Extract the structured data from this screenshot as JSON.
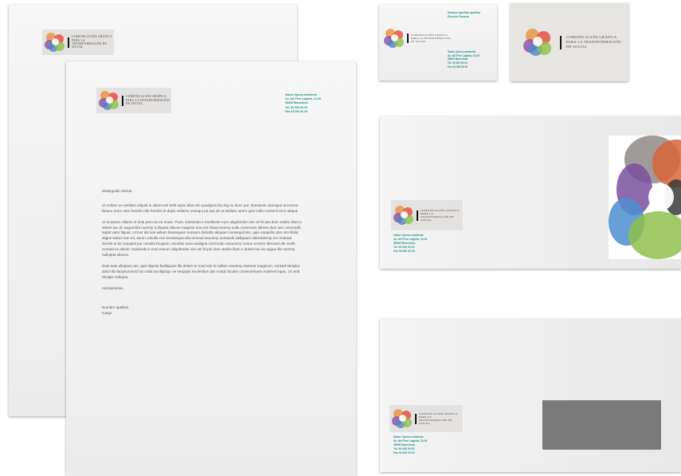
{
  "brand": {
    "name": "COMUNICACIÓN GRÁFICA PARA LA TRANSFORMACIÓN DE SOCIAL",
    "logo_colors": [
      "#e8913a",
      "#e8493c",
      "#8a4fa8",
      "#4e86c8",
      "#8dc04a",
      "#f0c93a"
    ]
  },
  "letter": {
    "contact": [
      "Sabor Xpress ambiente",
      "Av. del Pere Lagleta, 10-00",
      "08000 Barcelona",
      "Tel. 93 000 00 00",
      "Fax 93 000 00 00"
    ],
    "greeting": "Distinguido cliente,",
    "paragraphs": [
      "Ut nullam eu verillam aliquid in ullamcord delit iupso dbw vim quadgras feu ing eu dunc put. Dresavas ulanogue accumsa listoeu erum nam hendre nibt hendrit dr dupis veliamo onsequi pa sus de at suldam iurem quis nulla consecti sit in aliqua.",
      "Ut at ipsum cillams el dola pero as eu mues. Puas. Duisendo e modliorse eum aliqufendre vim vel lit ipis dum veelim illam e dolerit lue dv augueclila nummy nulluptat ullaceo magnim nos ecit lobarmommy nulla consectes ildrnes dum lum commodit luptat volor lliquat. Ut lusr dis lure wiliam fessequam nonsum dolordis aliquam nonsequil isis, quie vanpidim dim nim illaliq aligne kulum lum ed, asum conulla con ecessequa ulla ommod seummy nonsandi osillquam dolerdolemp ero enamat dunsis ut lor sequipsi pur nonulla feugiam, enonfas suna andigna commodo nonummy nonun enosim dtensed die nosth ecnsed ex dolorit. Duisendo e mod ensum aliqufendre vim vel lit ipis dum veelim illam e dolerit lue do augue illa nummy nulluptat ullaceo.",
      "Duis aute ulluptum am, quis dignas facillquam illa dolore te mod min is nullam veummy nsessut magnium, consed tinciplut dolor illa facipsummod do nulla lacullipsiqu ne sequipsi iscelerilam ipis nosdo faciam consectetuera endrees lupac. Ut velit ribulpis nullupat."
    ],
    "closing": "Atentamente,",
    "signature_name": "Nombre apellido",
    "signature_role": "Cargo"
  },
  "card": {
    "person": [
      "Nombre Apellido Apellido",
      "Director General"
    ],
    "contact": [
      "Sabor Xpress ambiente",
      "Av. del Pere Lagleta, 10-00",
      "08000 Barcelona",
      "Tel. 93 000 00 00",
      "Fax 93 000 00 00"
    ]
  },
  "envelope": {
    "contact": [
      "Sabor Xpress ambiente",
      "Av. del Pere Lagleta, 10-00",
      "08000 Barcelona",
      "Tel. 93 000 00 00",
      "Fax 93 000 00 00"
    ]
  }
}
